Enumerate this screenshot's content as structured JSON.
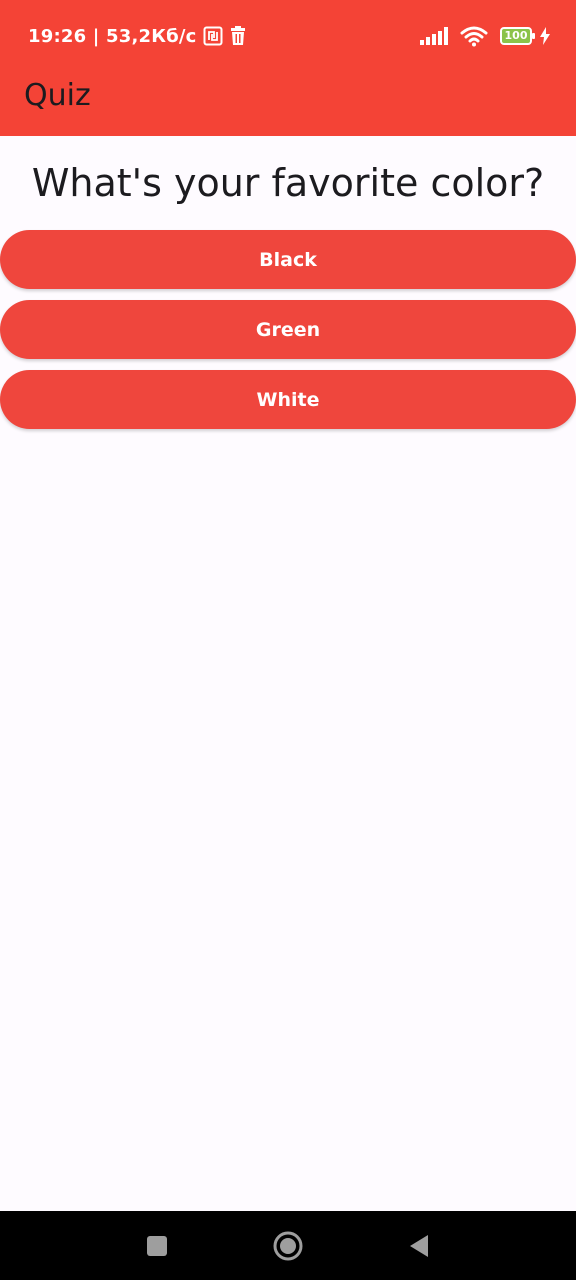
{
  "status_bar": {
    "time_and_speed": "19:26 | 53,2Кб/с",
    "battery_level": "100",
    "icons": [
      "nfc-icon",
      "delete-icon",
      "signal-icon",
      "wifi-icon",
      "battery-icon",
      "charging-icon"
    ]
  },
  "app_bar": {
    "title": "Quiz"
  },
  "quiz": {
    "question": "What's your favorite color?",
    "answers": [
      {
        "label": "Black"
      },
      {
        "label": "Green"
      },
      {
        "label": "White"
      }
    ]
  },
  "nav_bar": {
    "icons": [
      "recents-square-icon",
      "home-circle-icon",
      "back-triangle-icon"
    ]
  },
  "colors": {
    "primary": "#f44336",
    "button": "#ef463d",
    "background": "#fefbff",
    "text": "#1c1b1f",
    "battery": "#8bc34a"
  }
}
